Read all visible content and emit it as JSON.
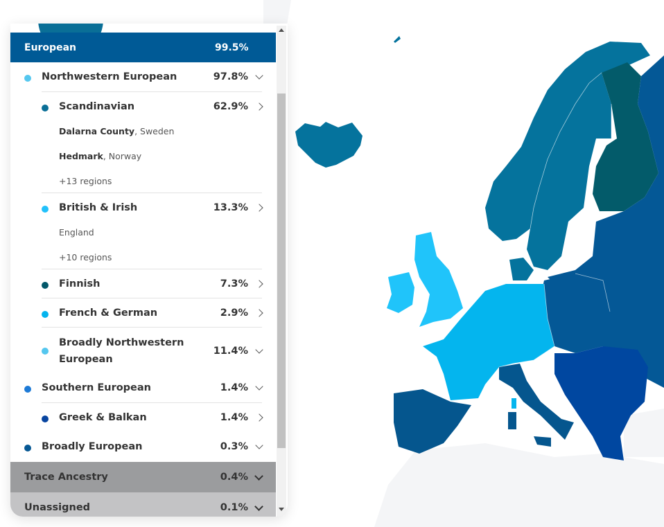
{
  "map": {
    "colors": {
      "scandinavian": "#05739d",
      "finnish": "#035b6a",
      "british_irish": "#20c4fa",
      "french_german": "#04b5ee",
      "eastern": "#045896",
      "balkan": "#0047a0",
      "italy_iberia": "#05568e",
      "land_other": "#f4f5f7"
    }
  },
  "panel": {
    "header": {
      "label": "European",
      "percent": "99.5%"
    },
    "groups": [
      {
        "label": "Northwestern European",
        "percent": "97.8%",
        "color": "#55c7ef",
        "chevron": "down"
      },
      {
        "label": "Scandinavian",
        "percent": "62.9%",
        "color": "#0a6f97",
        "chevron": "right",
        "regions": [
          {
            "bold": "Dalarna County",
            "rest": ", Sweden"
          },
          {
            "bold": "Hedmark",
            "rest": ", Norway"
          }
        ],
        "more": "+13 regions"
      },
      {
        "label": "British & Irish",
        "percent": "13.3%",
        "color": "#22c1fb",
        "chevron": "right",
        "regions": [
          {
            "bold": "",
            "rest": "England"
          }
        ],
        "more": "+10 regions"
      },
      {
        "label": "Finnish",
        "percent": "7.3%",
        "color": "#03586a",
        "chevron": "right"
      },
      {
        "label": "French & German",
        "percent": "2.9%",
        "color": "#05b4ee",
        "chevron": "right"
      },
      {
        "label_line1": "Broadly Northwestern",
        "label_line2": "European",
        "percent": "11.4%",
        "color": "#55c7ef",
        "chevron": "down"
      },
      {
        "label": "Southern European",
        "percent": "1.4%",
        "color": "#1d7ad6",
        "chevron": "down"
      },
      {
        "label": "Greek & Balkan",
        "percent": "1.4%",
        "color": "#0845a0",
        "chevron": "right"
      },
      {
        "label": "Broadly European",
        "percent": "0.3%",
        "color": "#075894",
        "chevron": "down"
      }
    ],
    "trace": {
      "label": "Trace Ancestry",
      "percent": "0.4%"
    },
    "unassigned": {
      "label": "Unassigned",
      "percent": "0.1%"
    }
  }
}
